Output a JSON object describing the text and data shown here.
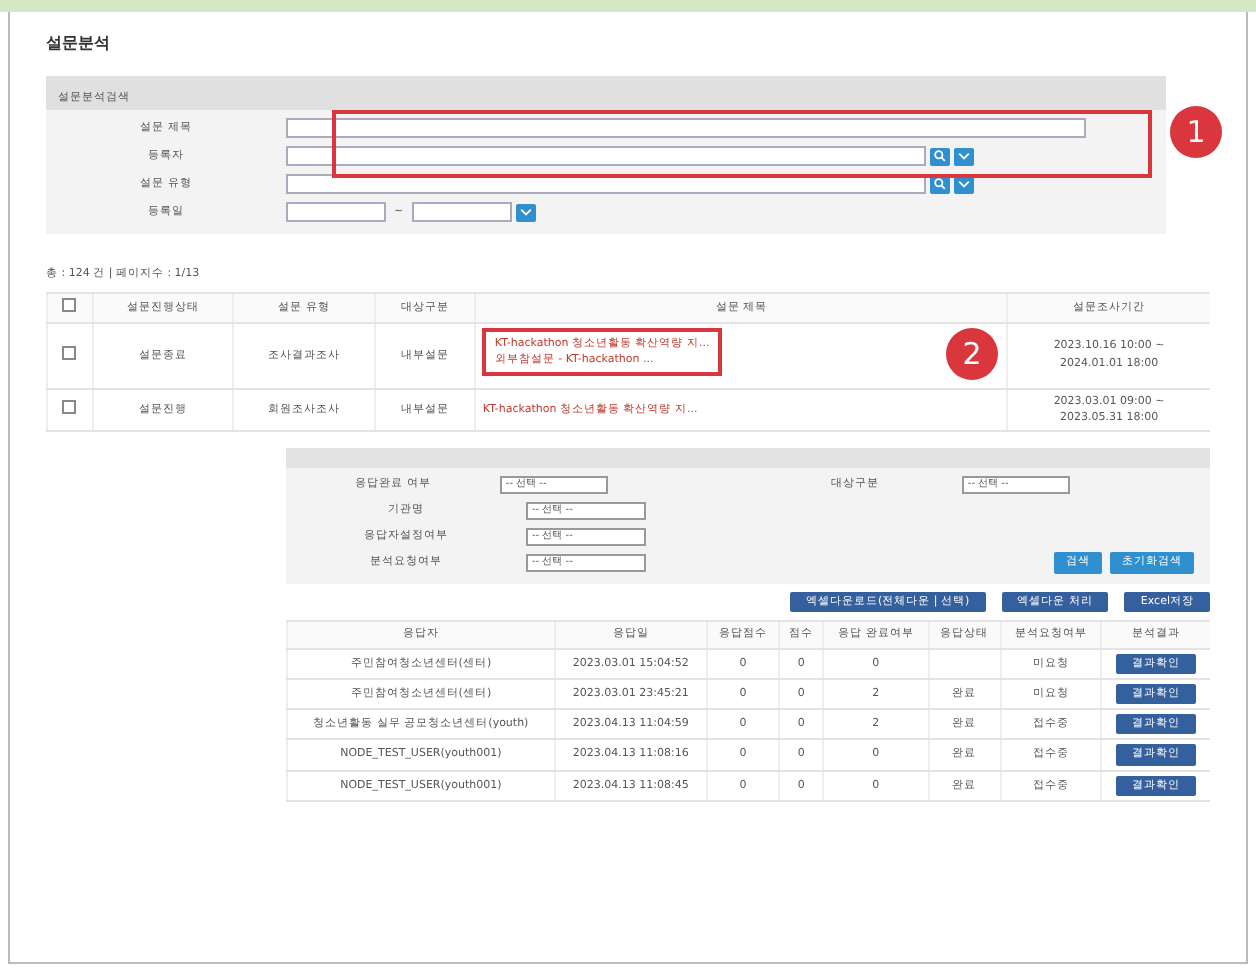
{
  "page_title": "설문분석",
  "search_panel": {
    "title": "설문분석검색",
    "fields": [
      {
        "label": "설문 제목",
        "kind": "text"
      },
      {
        "label": "등록자",
        "kind": "lookup"
      },
      {
        "label": "설문 유형",
        "kind": "lookup"
      },
      {
        "label": "등록일",
        "kind": "daterange",
        "separator": "~"
      }
    ]
  },
  "summary": "총 : 124 건 | 페이지수 : 1/13",
  "survey_table": {
    "select_all_checked": false,
    "columns": [
      "설문진행상태",
      "설문 유형",
      "대상구분",
      "설문 제목",
      "설문조사기간"
    ],
    "rows": [
      {
        "checked": false,
        "cells": [
          "설문종료",
          "조사결과조사",
          "내부설문"
        ],
        "title_lines": [
          "KT-hackathon 청소년활동 확산역량 지...",
          "외부참설문 - KT-hackathon ..."
        ],
        "period": [
          "2023.10.16 10:00 ~",
          "2024.01.01 18:00"
        ]
      },
      {
        "checked": false,
        "cells": [
          "설문진행",
          "회원조사조사",
          "내부설문"
        ],
        "title_lines": [
          "KT-hackathon 청소년활동 확산역량 지..."
        ],
        "period": [
          "2023.03.01 09:00 ~",
          "2023.05.31 18:00"
        ]
      }
    ]
  },
  "filter_panel": {
    "fields": [
      {
        "label": "응답완료 여부",
        "value": "-- 선택 --"
      },
      {
        "label": "대상구분",
        "value": "-- 선택 --"
      },
      {
        "label": "기관명",
        "value": "-- 선택 --"
      },
      {
        "label": "응답자설정여부",
        "value": "-- 선택 --"
      },
      {
        "label": "분석요청여부",
        "value": "-- 선택 --"
      }
    ],
    "buttons": [
      "검색",
      "초기화검색"
    ]
  },
  "action_buttons": [
    "엑셀다운로드(전체다운 | 선택)",
    "엑셀다운 처리",
    "Excel저장"
  ],
  "response_table": {
    "columns": [
      "응답자",
      "응답일",
      "응답점수",
      "점수",
      "응답 완료여부",
      "응답상태",
      "분석요청여부",
      "분석결과"
    ],
    "rows": [
      {
        "cells": [
          "주민참여청소년센터(센터)",
          "2023.03.01 15:04:52",
          "0",
          "0",
          "0",
          "",
          "미요청"
        ],
        "button": "결과확인"
      },
      {
        "cells": [
          "주민참여청소년센터(센터)",
          "2023.03.01 23:45:21",
          "0",
          "0",
          "2",
          "완료",
          "미요청"
        ],
        "button": "결과확인"
      },
      {
        "cells": [
          "청소년활동 실무 공모청소년센터(youth)",
          "2023.04.13 11:04:59",
          "0",
          "0",
          "2",
          "완료",
          "접수중"
        ],
        "button": "결과확인"
      },
      {
        "cells": [
          "NODE_TEST_USER(youth001)",
          "2023.04.13 11:08:16",
          "0",
          "0",
          "0",
          "완료",
          "접수중"
        ],
        "button": "결과확인"
      },
      {
        "cells": [
          "NODE_TEST_USER(youth001)",
          "2023.04.13 11:08:45",
          "0",
          "0",
          "0",
          "완료",
          "접수중"
        ],
        "button": "결과확인"
      }
    ]
  },
  "callouts": [
    {
      "number": "1"
    },
    {
      "number": "2"
    }
  ]
}
